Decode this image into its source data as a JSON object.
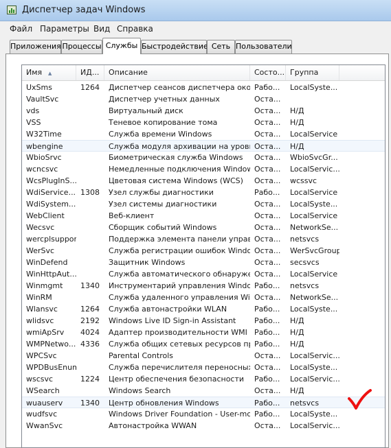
{
  "window": {
    "title": "Диспетчер задач Windows"
  },
  "menu": {
    "items": [
      "Файл",
      "Параметры",
      "Вид",
      "Справка"
    ]
  },
  "tabs": [
    {
      "label": "Приложения"
    },
    {
      "label": "Процессы"
    },
    {
      "label": "Службы"
    },
    {
      "label": "Быстродействие"
    },
    {
      "label": "Сеть"
    },
    {
      "label": "Пользователи"
    }
  ],
  "active_tab": "Службы",
  "columns": [
    "Имя",
    "ИД...",
    "Описание",
    "Состо...",
    "Группа"
  ],
  "sort_column": "Имя",
  "rows": [
    {
      "name": "UxSms",
      "pid": "1264",
      "desc": "Диспетчер сеансов диспетчера око...",
      "status": "Рабо...",
      "group": "LocalSyste..."
    },
    {
      "name": "VaultSvc",
      "pid": "",
      "desc": "Диспетчер учетных данных",
      "status": "Оста...",
      "group": ""
    },
    {
      "name": "vds",
      "pid": "",
      "desc": "Виртуальный диск",
      "status": "Оста...",
      "group": "Н/Д"
    },
    {
      "name": "VSS",
      "pid": "",
      "desc": "Теневое копирование тома",
      "status": "Оста...",
      "group": "Н/Д"
    },
    {
      "name": "W32Time",
      "pid": "",
      "desc": "Служба времени Windows",
      "status": "Оста...",
      "group": "LocalService"
    },
    {
      "name": "wbengine",
      "pid": "",
      "desc": "Служба модуля архивации на уровн...",
      "status": "Оста...",
      "group": "Н/Д"
    },
    {
      "name": "WbioSrvc",
      "pid": "",
      "desc": "Биометрическая служба Windows",
      "status": "Оста...",
      "group": "WbioSvcGr..."
    },
    {
      "name": "wcncsvc",
      "pid": "",
      "desc": "Немедленные подключения Window...",
      "status": "Оста...",
      "group": "LocalServic..."
    },
    {
      "name": "WcsPlugInS...",
      "pid": "",
      "desc": "Цветовая система Windows (WCS)",
      "status": "Оста...",
      "group": "wcssvc"
    },
    {
      "name": "WdiService...",
      "pid": "1308",
      "desc": "Узел службы диагностики",
      "status": "Рабо...",
      "group": "LocalService"
    },
    {
      "name": "WdiSystem...",
      "pid": "",
      "desc": "Узел системы диагностики",
      "status": "Оста...",
      "group": "LocalSyste..."
    },
    {
      "name": "WebClient",
      "pid": "",
      "desc": "Веб-клиент",
      "status": "Оста...",
      "group": "LocalService"
    },
    {
      "name": "Wecsvc",
      "pid": "",
      "desc": "Сборщик событий Windows",
      "status": "Оста...",
      "group": "NetworkSe..."
    },
    {
      "name": "wercplsupport",
      "pid": "",
      "desc": "Поддержка элемента панели управл...",
      "status": "Оста...",
      "group": "netsvcs"
    },
    {
      "name": "WerSvc",
      "pid": "",
      "desc": "Служба регистрации ошибок Windows",
      "status": "Оста...",
      "group": "WerSvcGroup"
    },
    {
      "name": "WinDefend",
      "pid": "",
      "desc": "Защитник Windows",
      "status": "Оста...",
      "group": "secsvcs"
    },
    {
      "name": "WinHttpAut...",
      "pid": "",
      "desc": "Служба автоматического обнаруже...",
      "status": "Оста...",
      "group": "LocalService"
    },
    {
      "name": "Winmgmt",
      "pid": "1340",
      "desc": "Инструментарий управления Windows",
      "status": "Рабо...",
      "group": "netsvcs"
    },
    {
      "name": "WinRM",
      "pid": "",
      "desc": "Служба удаленного управления Win...",
      "status": "Оста...",
      "group": "NetworkSe..."
    },
    {
      "name": "Wlansvc",
      "pid": "1264",
      "desc": "Служба автонастройки WLAN",
      "status": "Рабо...",
      "group": "LocalSyste..."
    },
    {
      "name": "wlidsvc",
      "pid": "2192",
      "desc": "Windows Live ID Sign-in Assistant",
      "status": "Рабо...",
      "group": "Н/Д"
    },
    {
      "name": "wmiApSrv",
      "pid": "4024",
      "desc": "Адаптер производительности WMI",
      "status": "Рабо...",
      "group": "Н/Д"
    },
    {
      "name": "WMPNetwo...",
      "pid": "4336",
      "desc": "Служба общих сетевых ресурсов пр...",
      "status": "Рабо...",
      "group": "Н/Д"
    },
    {
      "name": "WPCSvc",
      "pid": "",
      "desc": "Parental Controls",
      "status": "Оста...",
      "group": "LocalServic..."
    },
    {
      "name": "WPDBusEnum",
      "pid": "",
      "desc": "Служба перечислителя переносных ...",
      "status": "Оста...",
      "group": "LocalSyste..."
    },
    {
      "name": "wscsvc",
      "pid": "1224",
      "desc": "Центр обеспечения безопасности",
      "status": "Рабо...",
      "group": "LocalServic..."
    },
    {
      "name": "WSearch",
      "pid": "",
      "desc": "Windows Search",
      "status": "Оста...",
      "group": "Н/Д"
    },
    {
      "name": "wuauserv",
      "pid": "1340",
      "desc": "Центр обновления Windows",
      "status": "Рабо...",
      "group": "netsvcs"
    },
    {
      "name": "wudfsvc",
      "pid": "",
      "desc": "Windows Driver Foundation - User-mo...",
      "status": "Рабо...",
      "group": "LocalSyste..."
    },
    {
      "name": "WwanSvc",
      "pid": "",
      "desc": "Автонастройка WWAN",
      "status": "Оста...",
      "group": "LocalServic..."
    }
  ],
  "hover_rows": [
    "wbengine",
    "wuauserv"
  ],
  "annotation": {
    "checkmark_color": "#ee1111"
  }
}
